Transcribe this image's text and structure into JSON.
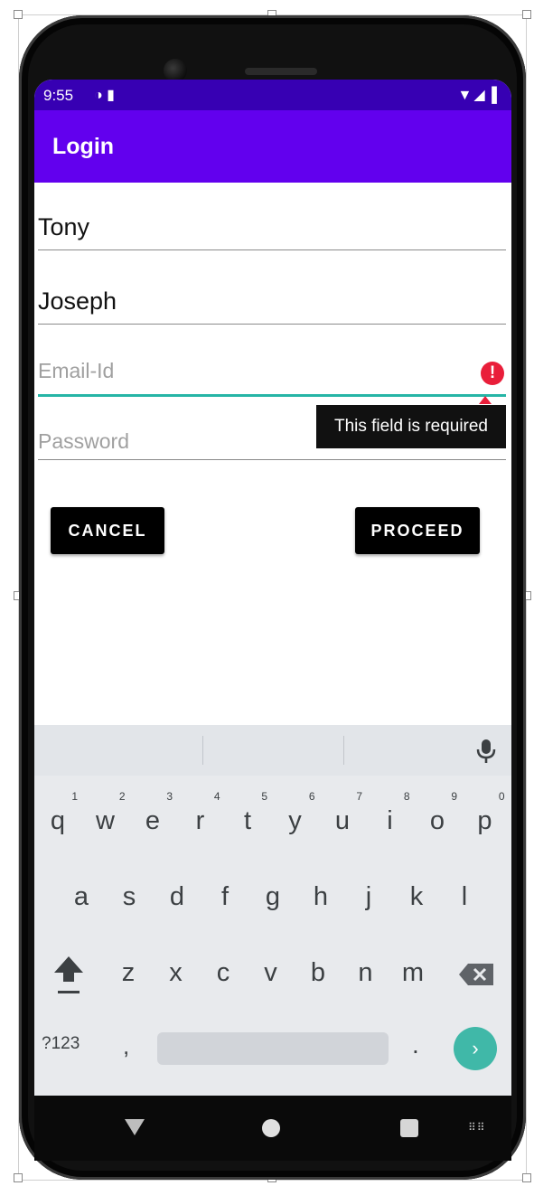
{
  "status_bar": {
    "time": "9:55",
    "left_icons": "◑ ▮",
    "right_icons": "▼◢▐"
  },
  "app_bar": {
    "title": "Login"
  },
  "form": {
    "first_name": {
      "value": "Tony"
    },
    "last_name": {
      "value": "Joseph"
    },
    "email": {
      "placeholder": "Email-Id",
      "error_icon": "!",
      "error_text": "This field is required"
    },
    "password": {
      "placeholder": "Password"
    }
  },
  "buttons": {
    "cancel": "CANCEL",
    "proceed": "PROCEED"
  },
  "keyboard": {
    "row1": [
      {
        "key": "q",
        "hint": "1"
      },
      {
        "key": "w",
        "hint": "2"
      },
      {
        "key": "e",
        "hint": "3"
      },
      {
        "key": "r",
        "hint": "4"
      },
      {
        "key": "t",
        "hint": "5"
      },
      {
        "key": "y",
        "hint": "6"
      },
      {
        "key": "u",
        "hint": "7"
      },
      {
        "key": "i",
        "hint": "8"
      },
      {
        "key": "o",
        "hint": "9"
      },
      {
        "key": "p",
        "hint": "0"
      }
    ],
    "row2": [
      "a",
      "s",
      "d",
      "f",
      "g",
      "h",
      "j",
      "k",
      "l"
    ],
    "row3": [
      "z",
      "x",
      "c",
      "v",
      "b",
      "n",
      "m"
    ],
    "symbols": "?123",
    "comma": ",",
    "period": ".",
    "enter": "›",
    "nav_keyboard_glyph": "⠿⠿"
  },
  "colors": {
    "status_bar": "#3700b3",
    "app_bar": "#6200ee",
    "focus_underline": "#26b5a6",
    "error": "#e91e3a",
    "enter_key": "#40b8a8",
    "button_bg": "#000000"
  }
}
